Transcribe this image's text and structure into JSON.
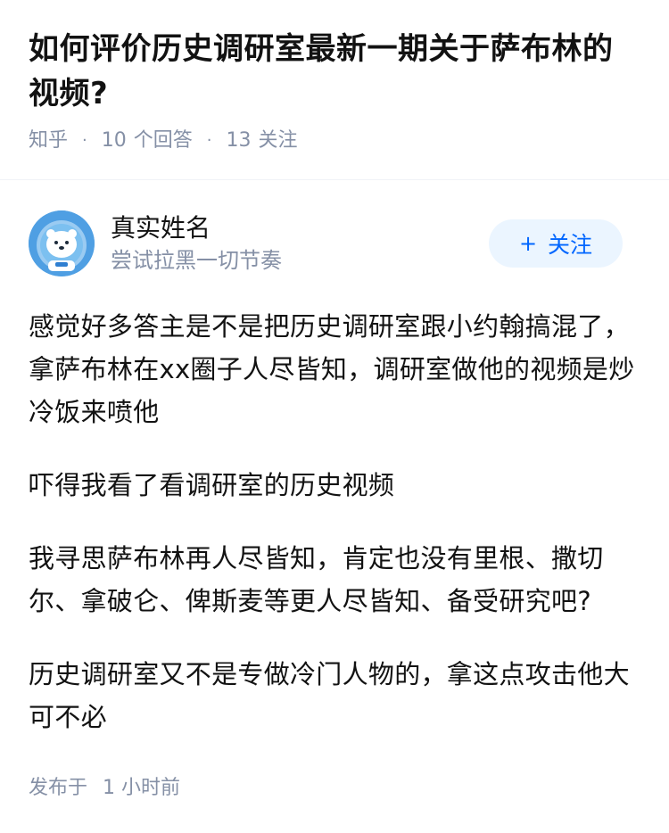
{
  "question": {
    "title": "如何评价历史调研室最新一期关于萨布林的视频?",
    "source": "知乎",
    "answer_count": "10",
    "answer_label": "个回答",
    "follower_count": "13",
    "follower_label": "关注"
  },
  "answer": {
    "author": {
      "name": "真实姓名",
      "bio": "尝试拉黑一切节奏",
      "avatar_icon": "polar-bear-astronaut-avatar"
    },
    "follow_button": {
      "plus": "+",
      "label": "关注"
    },
    "paragraphs": [
      "感觉好多答主是不是把历史调研室跟小约翰搞混了，拿萨布林在xx圈子人尽皆知，调研室做他的视频是炒冷饭来喷他",
      "吓得我看了看调研室的历史视频",
      "我寻思萨布林再人尽皆知，肯定也没有里根、撒切尔、拿破仑、俾斯麦等更人尽皆知、备受研究吧?",
      "历史调研室又不是专做冷门人物的，拿这点攻击他大可不必"
    ],
    "publish": {
      "label": "发布于",
      "time": "1 小时前"
    }
  },
  "colors": {
    "text_primary": "#121212",
    "text_secondary": "#8590a6",
    "accent": "#0066ff",
    "follow_bg": "#ebf5ff",
    "divider": "#f0f2f7"
  }
}
